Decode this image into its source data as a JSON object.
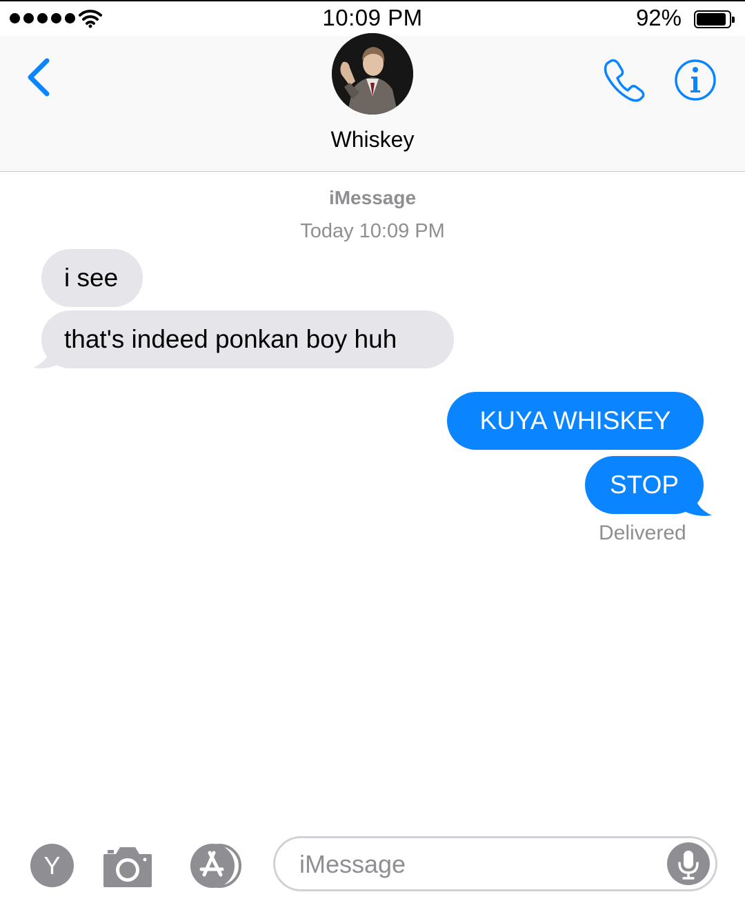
{
  "status_bar": {
    "time": "10:09 PM",
    "battery_percent": "92%",
    "battery_level": 0.92,
    "signal_bars": 5,
    "icons": [
      "signal-dots-icon",
      "wifi-icon",
      "battery-icon"
    ]
  },
  "header": {
    "contact_name": "Whiskey",
    "icons": [
      "back-chevron-icon",
      "phone-icon",
      "info-icon"
    ]
  },
  "thread": {
    "service": "iMessage",
    "timestamp": "Today 10:09 PM",
    "messages": [
      {
        "direction": "incoming",
        "text": "i see"
      },
      {
        "direction": "incoming",
        "text": "that's indeed ponkan boy huh"
      },
      {
        "direction": "outgoing",
        "text": "KUYA WHISKEY"
      },
      {
        "direction": "outgoing",
        "text": "STOP"
      }
    ],
    "delivery_status": "Delivered"
  },
  "toolbar": {
    "avatar_letter": "Y",
    "input_placeholder": "iMessage",
    "input_value": "",
    "icons": [
      "camera-icon",
      "app-store-icon",
      "microphone-icon"
    ]
  },
  "colors": {
    "accent": "#0a84ff",
    "incoming_bubble": "#e5e5ea",
    "secondary_text": "#8e8e93",
    "header_bg": "#f9f9f9"
  }
}
